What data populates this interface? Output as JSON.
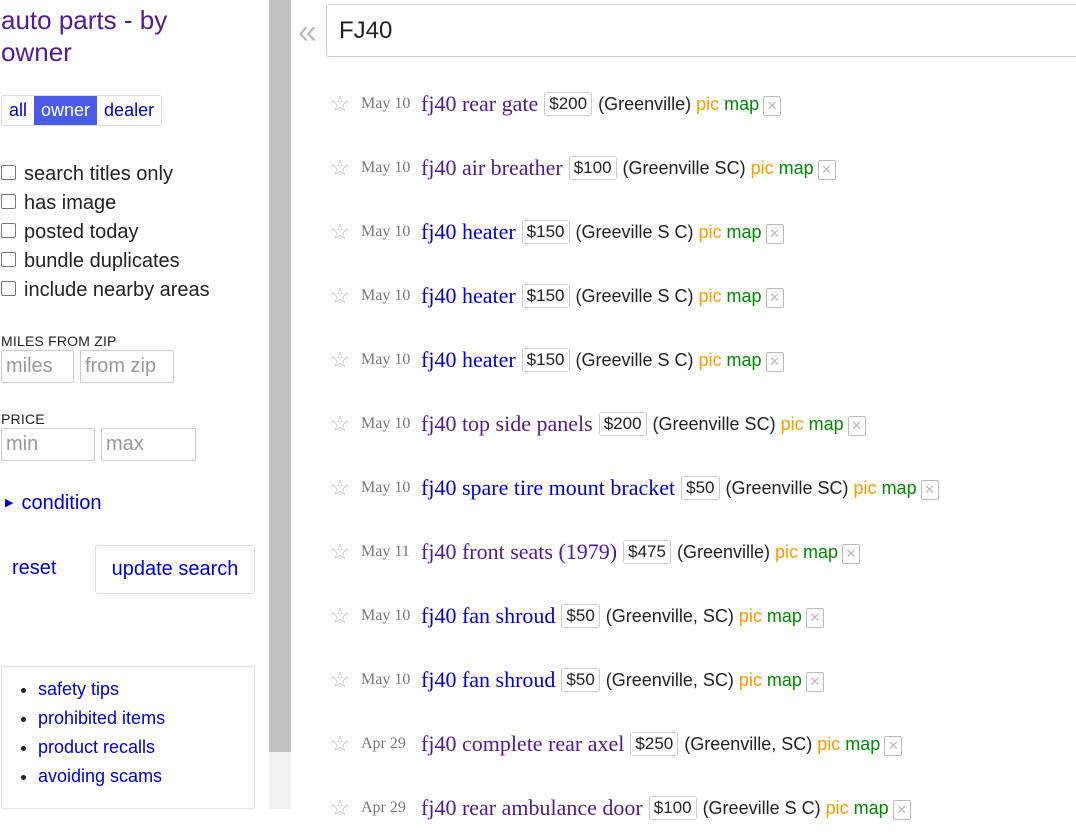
{
  "sidebar": {
    "category_title": "auto parts - by owner",
    "purveyor": [
      "all",
      "owner",
      "dealer"
    ],
    "purveyor_selected": "owner",
    "filters": [
      "search titles only",
      "has image",
      "posted today",
      "bundle duplicates",
      "include nearby areas"
    ],
    "miles_label": "MILES FROM ZIP",
    "miles_placeholder": "miles",
    "zip_placeholder": "from zip",
    "price_label": "PRICE",
    "price_min_placeholder": "min",
    "price_max_placeholder": "max",
    "condition_label": "condition",
    "reset_label": "reset",
    "update_label": "update search",
    "links": [
      "safety tips",
      "prohibited items",
      "product recalls",
      "avoiding scams"
    ]
  },
  "search": {
    "query": "FJ40",
    "collapse_icon": "double-chevron-left"
  },
  "results": [
    {
      "date": "May 10",
      "title": "fj40 rear gate",
      "price": "$200",
      "location": "(Greenville)",
      "pic": "pic",
      "map": "map",
      "visited": true
    },
    {
      "date": "May 10",
      "title": "fj40 air breather",
      "price": "$100",
      "location": "(Greenville SC)",
      "pic": "pic",
      "map": "map",
      "visited": true
    },
    {
      "date": "May 10",
      "title": "fj40 heater",
      "price": "$150",
      "location": "(Greeville S C)",
      "pic": "pic",
      "map": "map",
      "visited": false
    },
    {
      "date": "May 10",
      "title": "fj40 heater",
      "price": "$150",
      "location": "(Greeville S C)",
      "pic": "pic",
      "map": "map",
      "visited": false
    },
    {
      "date": "May 10",
      "title": "fj40 heater",
      "price": "$150",
      "location": "(Greeville S C)",
      "pic": "pic",
      "map": "map",
      "visited": false
    },
    {
      "date": "May 10",
      "title": "fj40 top side panels",
      "price": "$200",
      "location": "(Greenville SC)",
      "pic": "pic",
      "map": "map",
      "visited": true
    },
    {
      "date": "May 10",
      "title": "fj40 spare tire mount bracket",
      "price": "$50",
      "location": "(Greenville SC)",
      "pic": "pic",
      "map": "map",
      "visited": false
    },
    {
      "date": "May 11",
      "title": "fj40 front seats (1979)",
      "price": "$475",
      "location": "(Greenville)",
      "pic": "pic",
      "map": "map",
      "visited": true
    },
    {
      "date": "May 10",
      "title": "fj40 fan shroud",
      "price": "$50",
      "location": "(Greenville, SC)",
      "pic": "pic",
      "map": "map",
      "visited": false
    },
    {
      "date": "May 10",
      "title": "fj40 fan shroud",
      "price": "$50",
      "location": "(Greenville, SC)",
      "pic": "pic",
      "map": "map",
      "visited": false
    },
    {
      "date": "Apr 29",
      "title": "fj40 complete rear axel",
      "price": "$250",
      "location": "(Greenville, SC)",
      "pic": "pic",
      "map": "map",
      "visited": true
    },
    {
      "date": "Apr 29",
      "title": "fj40 rear ambulance door",
      "price": "$100",
      "location": "(Greeville S C)",
      "pic": "pic",
      "map": "map",
      "visited": true
    }
  ],
  "colors": {
    "link_blue": "#0000cc",
    "visited_purple": "#551a8b",
    "pic_orange": "#ff9900",
    "map_green": "#008a00",
    "selected_tab_bg": "#4a5ce6"
  }
}
